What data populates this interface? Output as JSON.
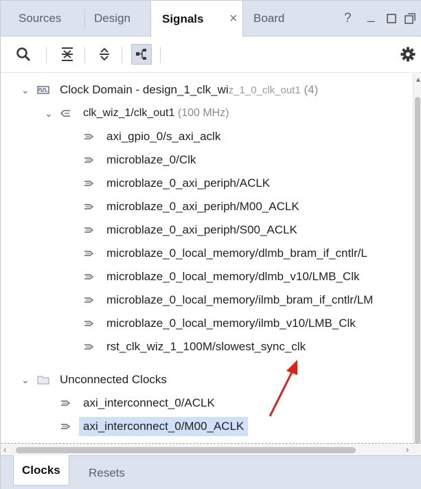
{
  "tabs": [
    {
      "label": "Sources"
    },
    {
      "label": "Design"
    },
    {
      "label": "Signals",
      "close": "×"
    },
    {
      "label": "Board"
    }
  ],
  "window_controls": {
    "help": "?",
    "minimize": "_"
  },
  "tree": {
    "clock_domain": {
      "label": "Clock Domain - design_1_clk_wi",
      "label_muted": "z_1_0_clk_out1",
      "count": "(4)"
    },
    "clock_source": {
      "label": "clk_wiz_1/clk_out1",
      "freq": "(100 MHz)"
    },
    "signals": [
      "axi_gpio_0/s_axi_aclk",
      "microblaze_0/Clk",
      "microblaze_0_axi_periph/ACLK",
      "microblaze_0_axi_periph/M00_ACLK",
      "microblaze_0_axi_periph/S00_ACLK",
      "microblaze_0_local_memory/dlmb_bram_if_cntlr/L",
      "microblaze_0_local_memory/dlmb_v10/LMB_Clk",
      "microblaze_0_local_memory/ilmb_bram_if_cntlr/LM",
      "microblaze_0_local_memory/ilmb_v10/LMB_Clk",
      "rst_clk_wiz_1_100M/slowest_sync_clk"
    ],
    "unconnected": {
      "label": "Unconnected Clocks",
      "items": [
        "axi_interconnect_0/ACLK",
        "axi_interconnect_0/M00_ACLK"
      ]
    }
  },
  "bottom_tabs": [
    {
      "label": "Clocks"
    },
    {
      "label": "Resets"
    }
  ],
  "colors": {
    "accent": "#cfe0f7",
    "arrow": "#e0201b"
  }
}
